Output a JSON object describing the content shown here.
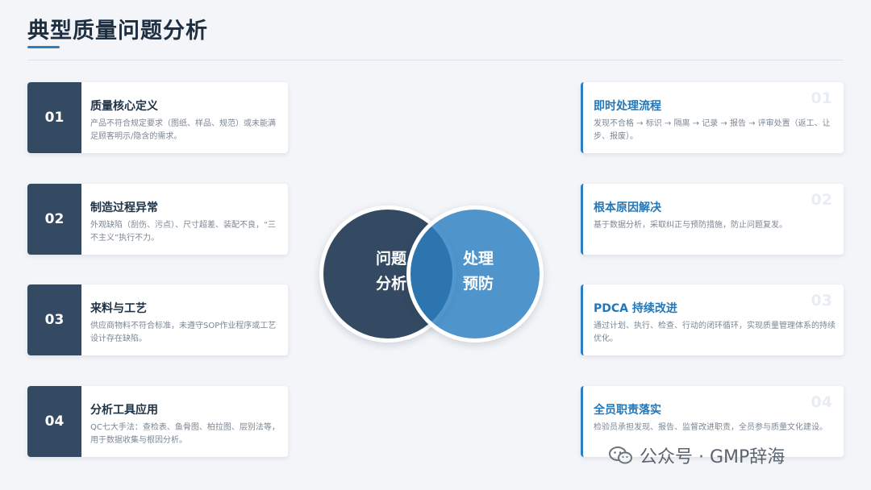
{
  "title": "典型质量问题分析",
  "left_cards": [
    {
      "num": "01",
      "title": "质量核心定义",
      "desc": "产品不符合规定要求（图纸、样品、规范）或未能满足顾客明示/隐含的需求。"
    },
    {
      "num": "02",
      "title": "制造过程异常",
      "desc": "外观缺陷（刮伤、污点）、尺寸超差、装配不良，“三不主义”执行不力。"
    },
    {
      "num": "03",
      "title": "来料与工艺",
      "desc": "供应商物料不符合标准，未遵守SOP作业程序或工艺设计存在缺陷。"
    },
    {
      "num": "04",
      "title": "分析工具应用",
      "desc": "QC七大手法：查检表、鱼骨图、柏拉图、层别法等，用于数据收集与根因分析。"
    }
  ],
  "right_cards": [
    {
      "num": "01",
      "title": "即时处理流程",
      "desc": "发现不合格 → 标识 → 隔离 → 记录 → 报告 → 评审处置（返工、让步、报废）。"
    },
    {
      "num": "02",
      "title": "根本原因解决",
      "desc": "基于数据分析，采取纠正与预防措施，防止问题复发。"
    },
    {
      "num": "03",
      "title": "PDCA 持续改进",
      "desc": "通过计划、执行、检查、行动的闭环循环，实现质量管理体系的持续优化。"
    },
    {
      "num": "04",
      "title": "全员职责落实",
      "desc": "检验员承担发现、报告、监督改进职责，全员参与质量文化建设。"
    }
  ],
  "venn": {
    "left_line1": "问题",
    "left_line2": "分析",
    "right_line1": "处理",
    "right_line2": "预防"
  },
  "watermark": "公众号 · GMP辞海",
  "colors": {
    "dark": "#344a62",
    "accent": "#2b7fc1"
  }
}
